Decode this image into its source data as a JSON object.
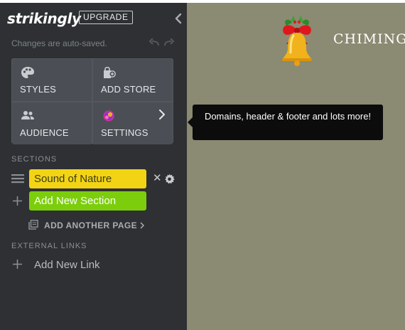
{
  "sidebar": {
    "logo": "strikingly",
    "upgrade_label": "UPGRADE",
    "autosave_text": "Changes are auto-saved.",
    "tiles": [
      {
        "label": "STYLES",
        "icon": "palette-icon"
      },
      {
        "label": "ADD STORE",
        "icon": "store-bag-icon"
      },
      {
        "label": "AUDIENCE",
        "icon": "people-icon"
      },
      {
        "label": "SETTINGS",
        "icon": "settings-badge-icon"
      }
    ],
    "sections_heading": "SECTIONS",
    "sections": [
      {
        "label": "Sound of Nature",
        "color": "#f2d414"
      }
    ],
    "add_section_label": "Add New Section",
    "add_section_color": "#7cce0c",
    "add_page_label": "ADD ANOTHER PAGE",
    "external_heading": "EXTERNAL LINKS",
    "add_link_label": "Add New Link"
  },
  "tooltip": {
    "text": "Domains, header & footer and lots more!"
  },
  "preview": {
    "brand": "CHIMING",
    "background": "#8b8a72"
  }
}
